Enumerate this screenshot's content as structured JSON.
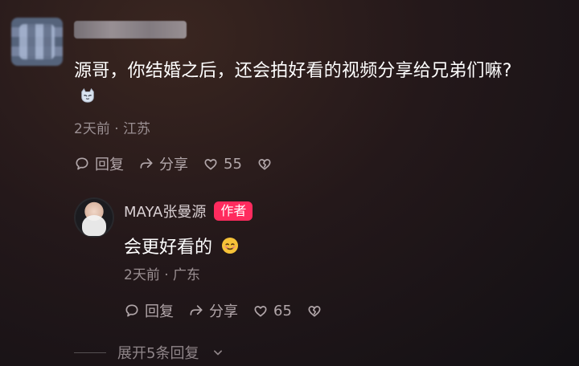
{
  "comment": {
    "user_name": "",
    "text": "源哥，你结婚之后，还会拍好看的视频分享给兄弟们嘛?",
    "meta": "2天前 · 江苏",
    "actions": {
      "reply": "回复",
      "share": "分享",
      "likes": "55"
    }
  },
  "reply": {
    "user_name": "MAYA张曼源",
    "badge": "作者",
    "text": "会更好看的",
    "meta": "2天前 · 广东",
    "actions": {
      "reply": "回复",
      "share": "分享",
      "likes": "65"
    }
  },
  "expand": {
    "label": "展开5条回复"
  },
  "icons": {
    "reply": "comment-bubble-icon",
    "share": "share-arrow-icon",
    "like": "heart-icon",
    "dislike": "broken-heart-icon",
    "emoji_cat": "cat-emoji-icon",
    "emoji_smile": "smile-emoji-icon",
    "chevron": "chevron-down-icon"
  },
  "colors": {
    "badge_bg": "#ff2b5e",
    "muted_text": "#9a8f92",
    "action_text": "#b2a7aa"
  }
}
